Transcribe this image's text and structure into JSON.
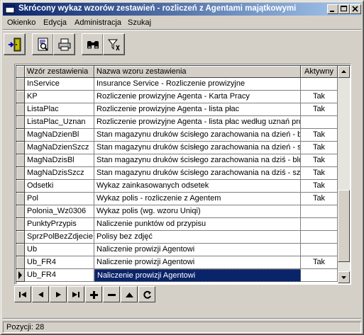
{
  "window": {
    "title": "Skrócony wykaz wzorów zestawień - rozliczeń z Agentami majątkowymi"
  },
  "menu": [
    "Okienko",
    "Edycja",
    "Administracja",
    "Szukaj"
  ],
  "toolbar": {
    "icons": [
      "exit-door-icon",
      "preview-icon",
      "print-icon",
      "binoculars-icon",
      "filter-icon"
    ]
  },
  "grid": {
    "columns": [
      "Wzór zestawienia",
      "Nazwa wzoru zestawienia",
      "Aktywny"
    ],
    "rows": [
      {
        "code": "InService",
        "name": "Insurance Service - Rozliczenie prowizyjne",
        "active": ""
      },
      {
        "code": "KP",
        "name": "Rozliczenie prowizyjne Agenta - Karta Pracy",
        "active": "Tak"
      },
      {
        "code": "ListaPlac",
        "name": "Rozliczenie prowizyjne Agenta - lista płac",
        "active": "Tak"
      },
      {
        "code": "ListaPlac_Uznan",
        "name": "Rozliczenie prowizyjne Agenta - lista płac według uznań prow",
        "active": ""
      },
      {
        "code": "MagNaDzienBl",
        "name": "Stan magazynu druków ścisłego zarachowania na dzień - blo",
        "active": "Tak"
      },
      {
        "code": "MagNaDzienSzcz",
        "name": "Stan magazynu druków ścisłego zarachowania na dzień - szc",
        "active": "Tak"
      },
      {
        "code": "MagNaDzisBl",
        "name": "Stan magazynu druków ścisłego zarachowania na dziś - bloc",
        "active": "Tak"
      },
      {
        "code": "MagNaDzisSzcz",
        "name": "Stan magazynu druków ścisłego zarachowania na dziś - szcz",
        "active": "Tak"
      },
      {
        "code": "Odsetki",
        "name": "Wykaz zainkasowanych odsetek",
        "active": "Tak"
      },
      {
        "code": "Pol",
        "name": "Wykaz polis - rozliczenie z Agentem",
        "active": "Tak"
      },
      {
        "code": "Polonia_Wz0306",
        "name": "Wykaz polis (wg. wzoru Uniqi)",
        "active": ""
      },
      {
        "code": "PunktyPrzypis",
        "name": "Naliczenie punktów od przypisu",
        "active": ""
      },
      {
        "code": "SprzPolBezZdjecie",
        "name": "Polisy bez zdjęć",
        "active": ""
      },
      {
        "code": "Ub",
        "name": "Naliczenie prowizji Agentowi",
        "active": ""
      },
      {
        "code": "Ub_FR4",
        "name": "Naliczenie prowizji Agentowi",
        "active": "Tak"
      },
      {
        "code": "Ub_FR4",
        "name": "Naliczenie prowizji Agentowi",
        "active": ""
      }
    ],
    "selected_row": 15
  },
  "navigator": {
    "icons": [
      "first-record-icon",
      "prior-record-icon",
      "next-record-icon",
      "last-record-icon",
      "insert-record-icon",
      "delete-record-icon",
      "edit-record-icon",
      "refresh-icon"
    ]
  },
  "status": {
    "text": "Pozycji: 28"
  },
  "colors": {
    "selection": "#0a246a",
    "titlebar_start": "#0a246a",
    "titlebar_end": "#a6caf0"
  }
}
